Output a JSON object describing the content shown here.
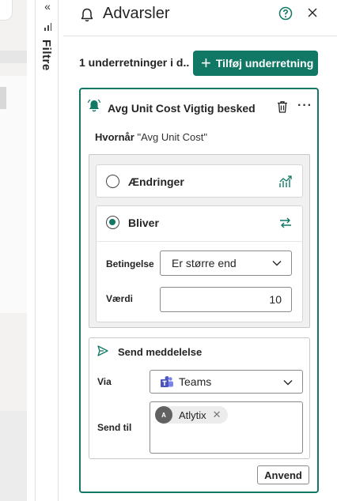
{
  "filter_strip": {
    "collapse_icon": "double-chevron-left",
    "label": "Filtre"
  },
  "pane": {
    "title": "Advarsler",
    "icons": [
      "bell-icon",
      "help-icon",
      "close-icon"
    ]
  },
  "toolbar": {
    "count_text": "1 underretninger i d...",
    "add_button_label": "Tilføj underretning"
  },
  "alert": {
    "title": "Avg Unit Cost Vigtig besked",
    "when_label": "Hvornår",
    "when_value": "\"Avg Unit Cost\"",
    "options": [
      {
        "label": "Ændringer",
        "selected": false,
        "icon": "trend-chart-icon"
      },
      {
        "label": "Bliver",
        "selected": true,
        "icon": "arrows-icon"
      }
    ],
    "condition_label": "Betingelse",
    "condition_value": "Er større end",
    "value_label": "Værdi",
    "value": "10",
    "send_title": "Send meddelelse",
    "via_label": "Via",
    "via_value": "Teams",
    "send_to_label": "Send til",
    "recipient": {
      "initial": "A",
      "name": "Atlytix"
    },
    "apply_label": "Anvend"
  },
  "colors": {
    "accent": "#117865",
    "border": "#c8c8c8",
    "teams": "#5059c9"
  }
}
